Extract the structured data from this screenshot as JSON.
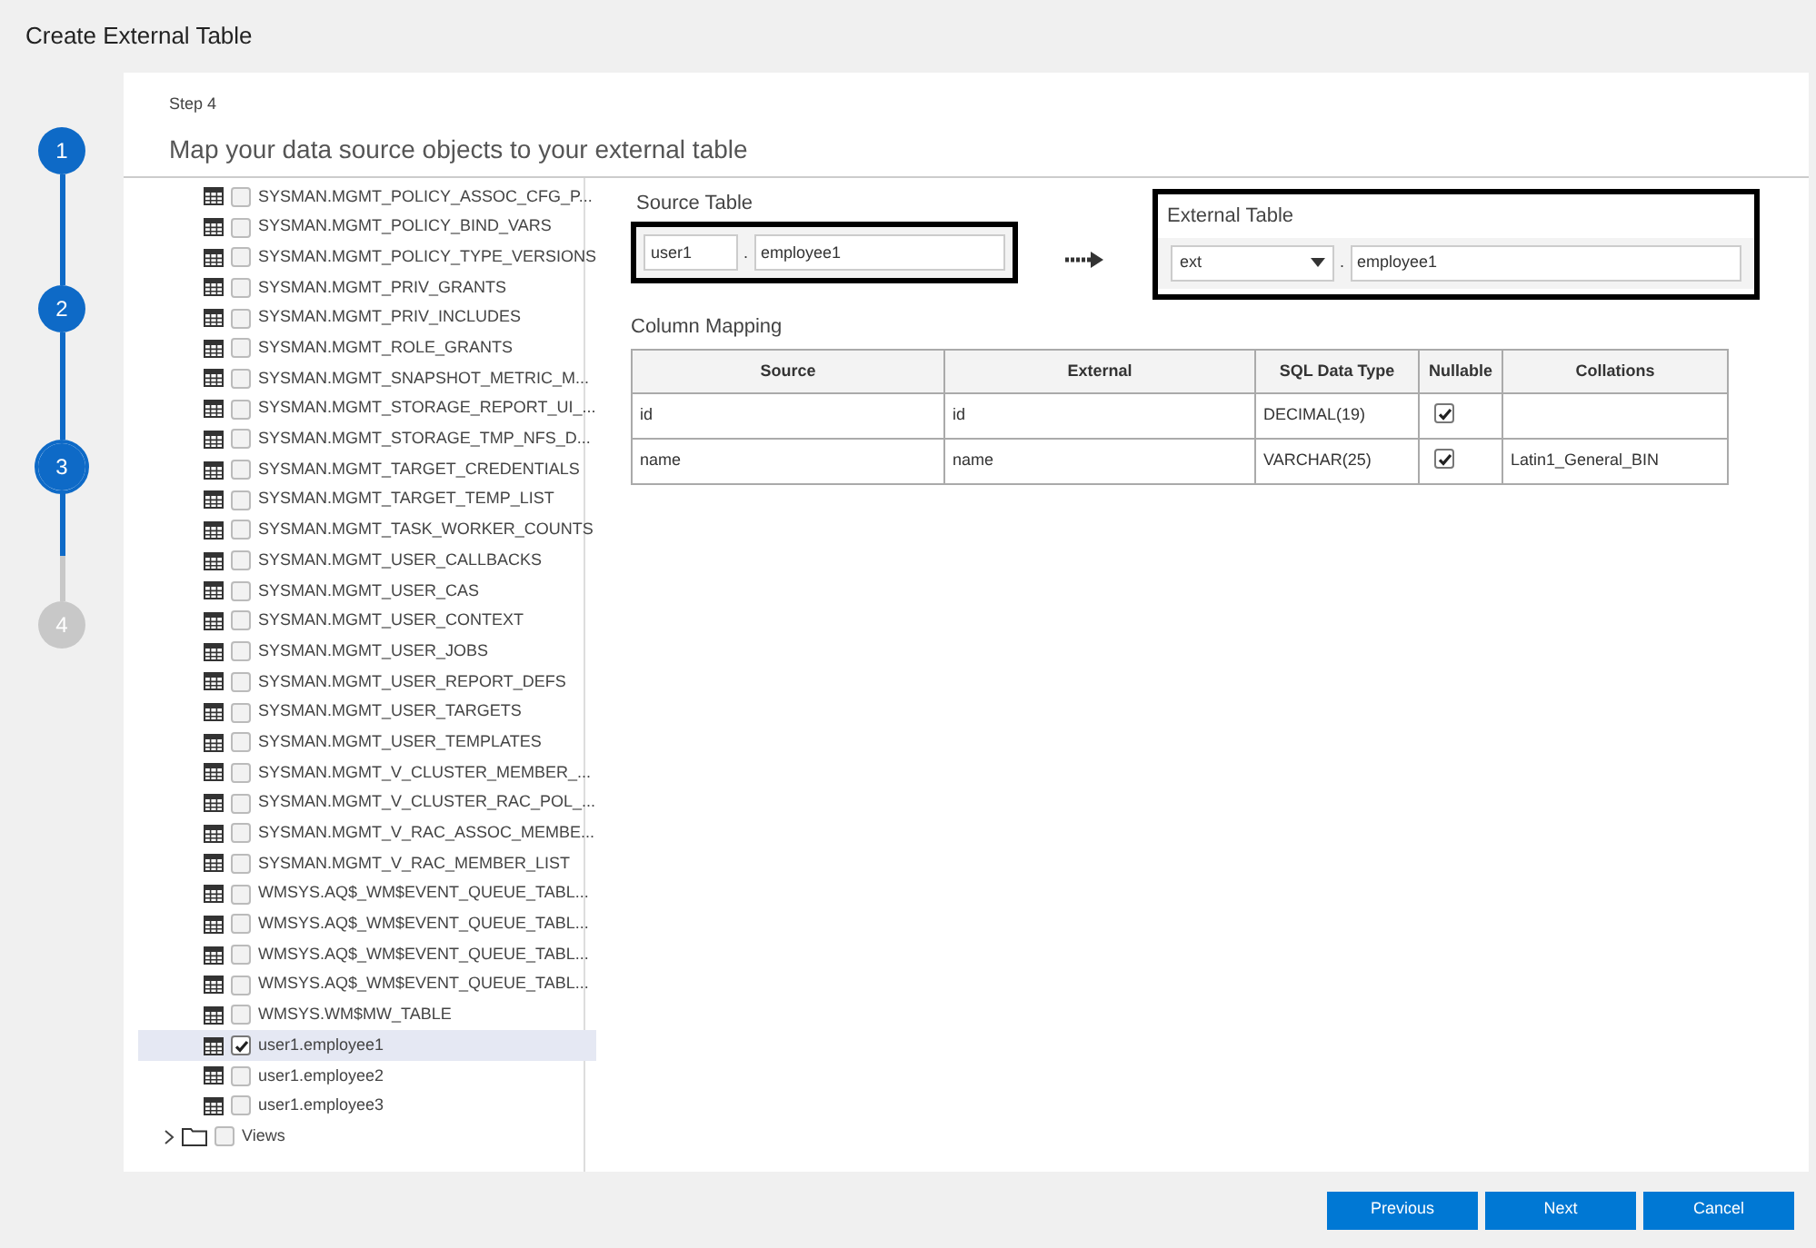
{
  "window": {
    "title": "Create External Table"
  },
  "steps": [
    {
      "label": "1",
      "kind": "done"
    },
    {
      "label": "2",
      "kind": "done"
    },
    {
      "label": "3",
      "kind": "current"
    },
    {
      "label": "4",
      "kind": "pending"
    }
  ],
  "header": {
    "step": "Step 4",
    "title": "Map your data source objects to your external table"
  },
  "tree": {
    "items": [
      {
        "kind": "table",
        "name": "SYSMAN.MGMT_POLICY_ASSOC_CFG_P...",
        "checked": false,
        "selected": false
      },
      {
        "kind": "table",
        "name": "SYSMAN.MGMT_POLICY_BIND_VARS",
        "checked": false,
        "selected": false
      },
      {
        "kind": "table",
        "name": "SYSMAN.MGMT_POLICY_TYPE_VERSIONS",
        "checked": false,
        "selected": false
      },
      {
        "kind": "table",
        "name": "SYSMAN.MGMT_PRIV_GRANTS",
        "checked": false,
        "selected": false
      },
      {
        "kind": "table",
        "name": "SYSMAN.MGMT_PRIV_INCLUDES",
        "checked": false,
        "selected": false
      },
      {
        "kind": "table",
        "name": "SYSMAN.MGMT_ROLE_GRANTS",
        "checked": false,
        "selected": false
      },
      {
        "kind": "table",
        "name": "SYSMAN.MGMT_SNAPSHOT_METRIC_M...",
        "checked": false,
        "selected": false
      },
      {
        "kind": "table",
        "name": "SYSMAN.MGMT_STORAGE_REPORT_UI_...",
        "checked": false,
        "selected": false
      },
      {
        "kind": "table",
        "name": "SYSMAN.MGMT_STORAGE_TMP_NFS_D...",
        "checked": false,
        "selected": false
      },
      {
        "kind": "table",
        "name": "SYSMAN.MGMT_TARGET_CREDENTIALS",
        "checked": false,
        "selected": false
      },
      {
        "kind": "table",
        "name": "SYSMAN.MGMT_TARGET_TEMP_LIST",
        "checked": false,
        "selected": false
      },
      {
        "kind": "table",
        "name": "SYSMAN.MGMT_TASK_WORKER_COUNTS",
        "checked": false,
        "selected": false
      },
      {
        "kind": "table",
        "name": "SYSMAN.MGMT_USER_CALLBACKS",
        "checked": false,
        "selected": false
      },
      {
        "kind": "table",
        "name": "SYSMAN.MGMT_USER_CAS",
        "checked": false,
        "selected": false
      },
      {
        "kind": "table",
        "name": "SYSMAN.MGMT_USER_CONTEXT",
        "checked": false,
        "selected": false
      },
      {
        "kind": "table",
        "name": "SYSMAN.MGMT_USER_JOBS",
        "checked": false,
        "selected": false
      },
      {
        "kind": "table",
        "name": "SYSMAN.MGMT_USER_REPORT_DEFS",
        "checked": false,
        "selected": false
      },
      {
        "kind": "table",
        "name": "SYSMAN.MGMT_USER_TARGETS",
        "checked": false,
        "selected": false
      },
      {
        "kind": "table",
        "name": "SYSMAN.MGMT_USER_TEMPLATES",
        "checked": false,
        "selected": false
      },
      {
        "kind": "table",
        "name": "SYSMAN.MGMT_V_CLUSTER_MEMBER_...",
        "checked": false,
        "selected": false
      },
      {
        "kind": "table",
        "name": "SYSMAN.MGMT_V_CLUSTER_RAC_POL_...",
        "checked": false,
        "selected": false
      },
      {
        "kind": "table",
        "name": "SYSMAN.MGMT_V_RAC_ASSOC_MEMBE...",
        "checked": false,
        "selected": false
      },
      {
        "kind": "table",
        "name": "SYSMAN.MGMT_V_RAC_MEMBER_LIST",
        "checked": false,
        "selected": false
      },
      {
        "kind": "table",
        "name": "WMSYS.AQ$_WM$EVENT_QUEUE_TABL...",
        "checked": false,
        "selected": false
      },
      {
        "kind": "table",
        "name": "WMSYS.AQ$_WM$EVENT_QUEUE_TABL...",
        "checked": false,
        "selected": false
      },
      {
        "kind": "table",
        "name": "WMSYS.AQ$_WM$EVENT_QUEUE_TABL...",
        "checked": false,
        "selected": false
      },
      {
        "kind": "table",
        "name": "WMSYS.AQ$_WM$EVENT_QUEUE_TABL...",
        "checked": false,
        "selected": false
      },
      {
        "kind": "table",
        "name": "WMSYS.WM$MW_TABLE",
        "checked": false,
        "selected": false
      },
      {
        "kind": "table",
        "name": "user1.employee1",
        "checked": true,
        "selected": true
      },
      {
        "kind": "table",
        "name": "user1.employee2",
        "checked": false,
        "selected": false
      },
      {
        "kind": "table",
        "name": "user1.employee3",
        "checked": false,
        "selected": false
      },
      {
        "kind": "folder",
        "name": "Views",
        "checked": false,
        "selected": false,
        "expanded": false
      }
    ]
  },
  "source_table": {
    "label": "Source Table",
    "schema": "user1",
    "separator": ".",
    "table": "employee1"
  },
  "external_table": {
    "label": "External Table",
    "schema": "ext",
    "separator": ".",
    "table": "employee1"
  },
  "column_mapping": {
    "title": "Column Mapping",
    "columns": [
      "Source",
      "External",
      "SQL Data Type",
      "Nullable",
      "Collations"
    ],
    "rows": [
      {
        "source": "id",
        "external": "id",
        "type": "DECIMAL(19)",
        "nullable": true
      },
      {
        "source": "name",
        "external": "name",
        "type": "VARCHAR(25)",
        "nullable": true,
        "collation": "Latin1_General_BIN"
      }
    ]
  },
  "buttons": [
    "Previous",
    "Next",
    "Cancel"
  ]
}
